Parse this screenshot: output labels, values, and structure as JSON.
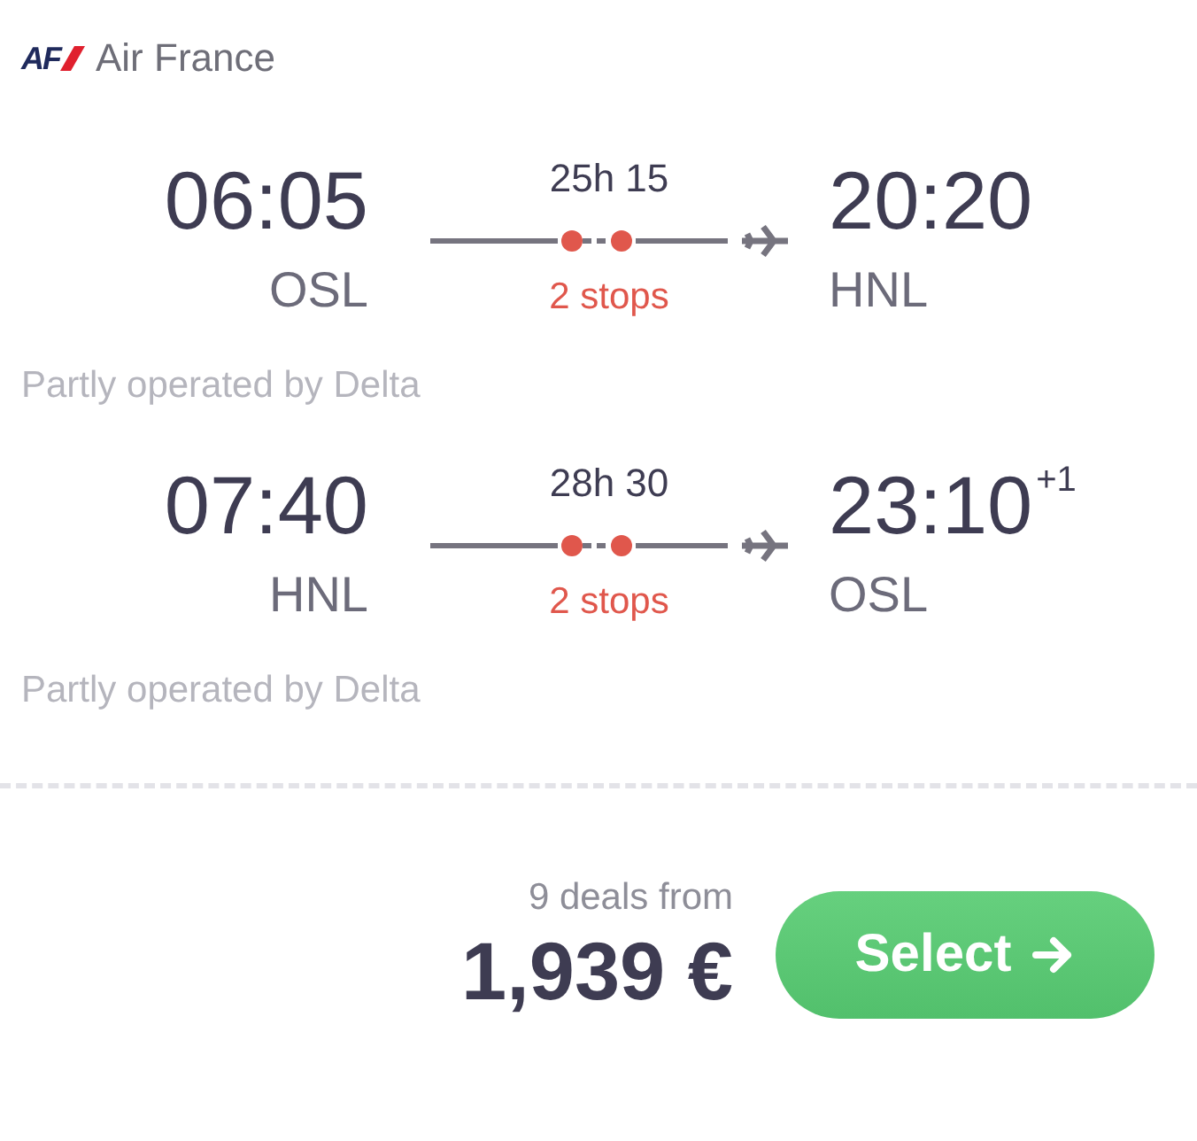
{
  "airline": {
    "logo_text": "AF",
    "name": "Air France"
  },
  "legs": [
    {
      "departure_time": "06:05",
      "departure_airport": "OSL",
      "duration": "25h 15",
      "stops": "2 stops",
      "arrival_time": "20:20",
      "arrival_airport": "HNL",
      "operator_note": "Partly operated by Delta"
    },
    {
      "departure_time": "07:40",
      "departure_airport": "HNL",
      "duration": "28h 30",
      "stops": "2 stops",
      "arrival_time": "23:10",
      "day_offset": "+1",
      "arrival_airport": "OSL",
      "operator_note": "Partly operated by Delta"
    }
  ],
  "footer": {
    "deals": "9 deals from",
    "price": "1,939 €",
    "button": "Select"
  }
}
